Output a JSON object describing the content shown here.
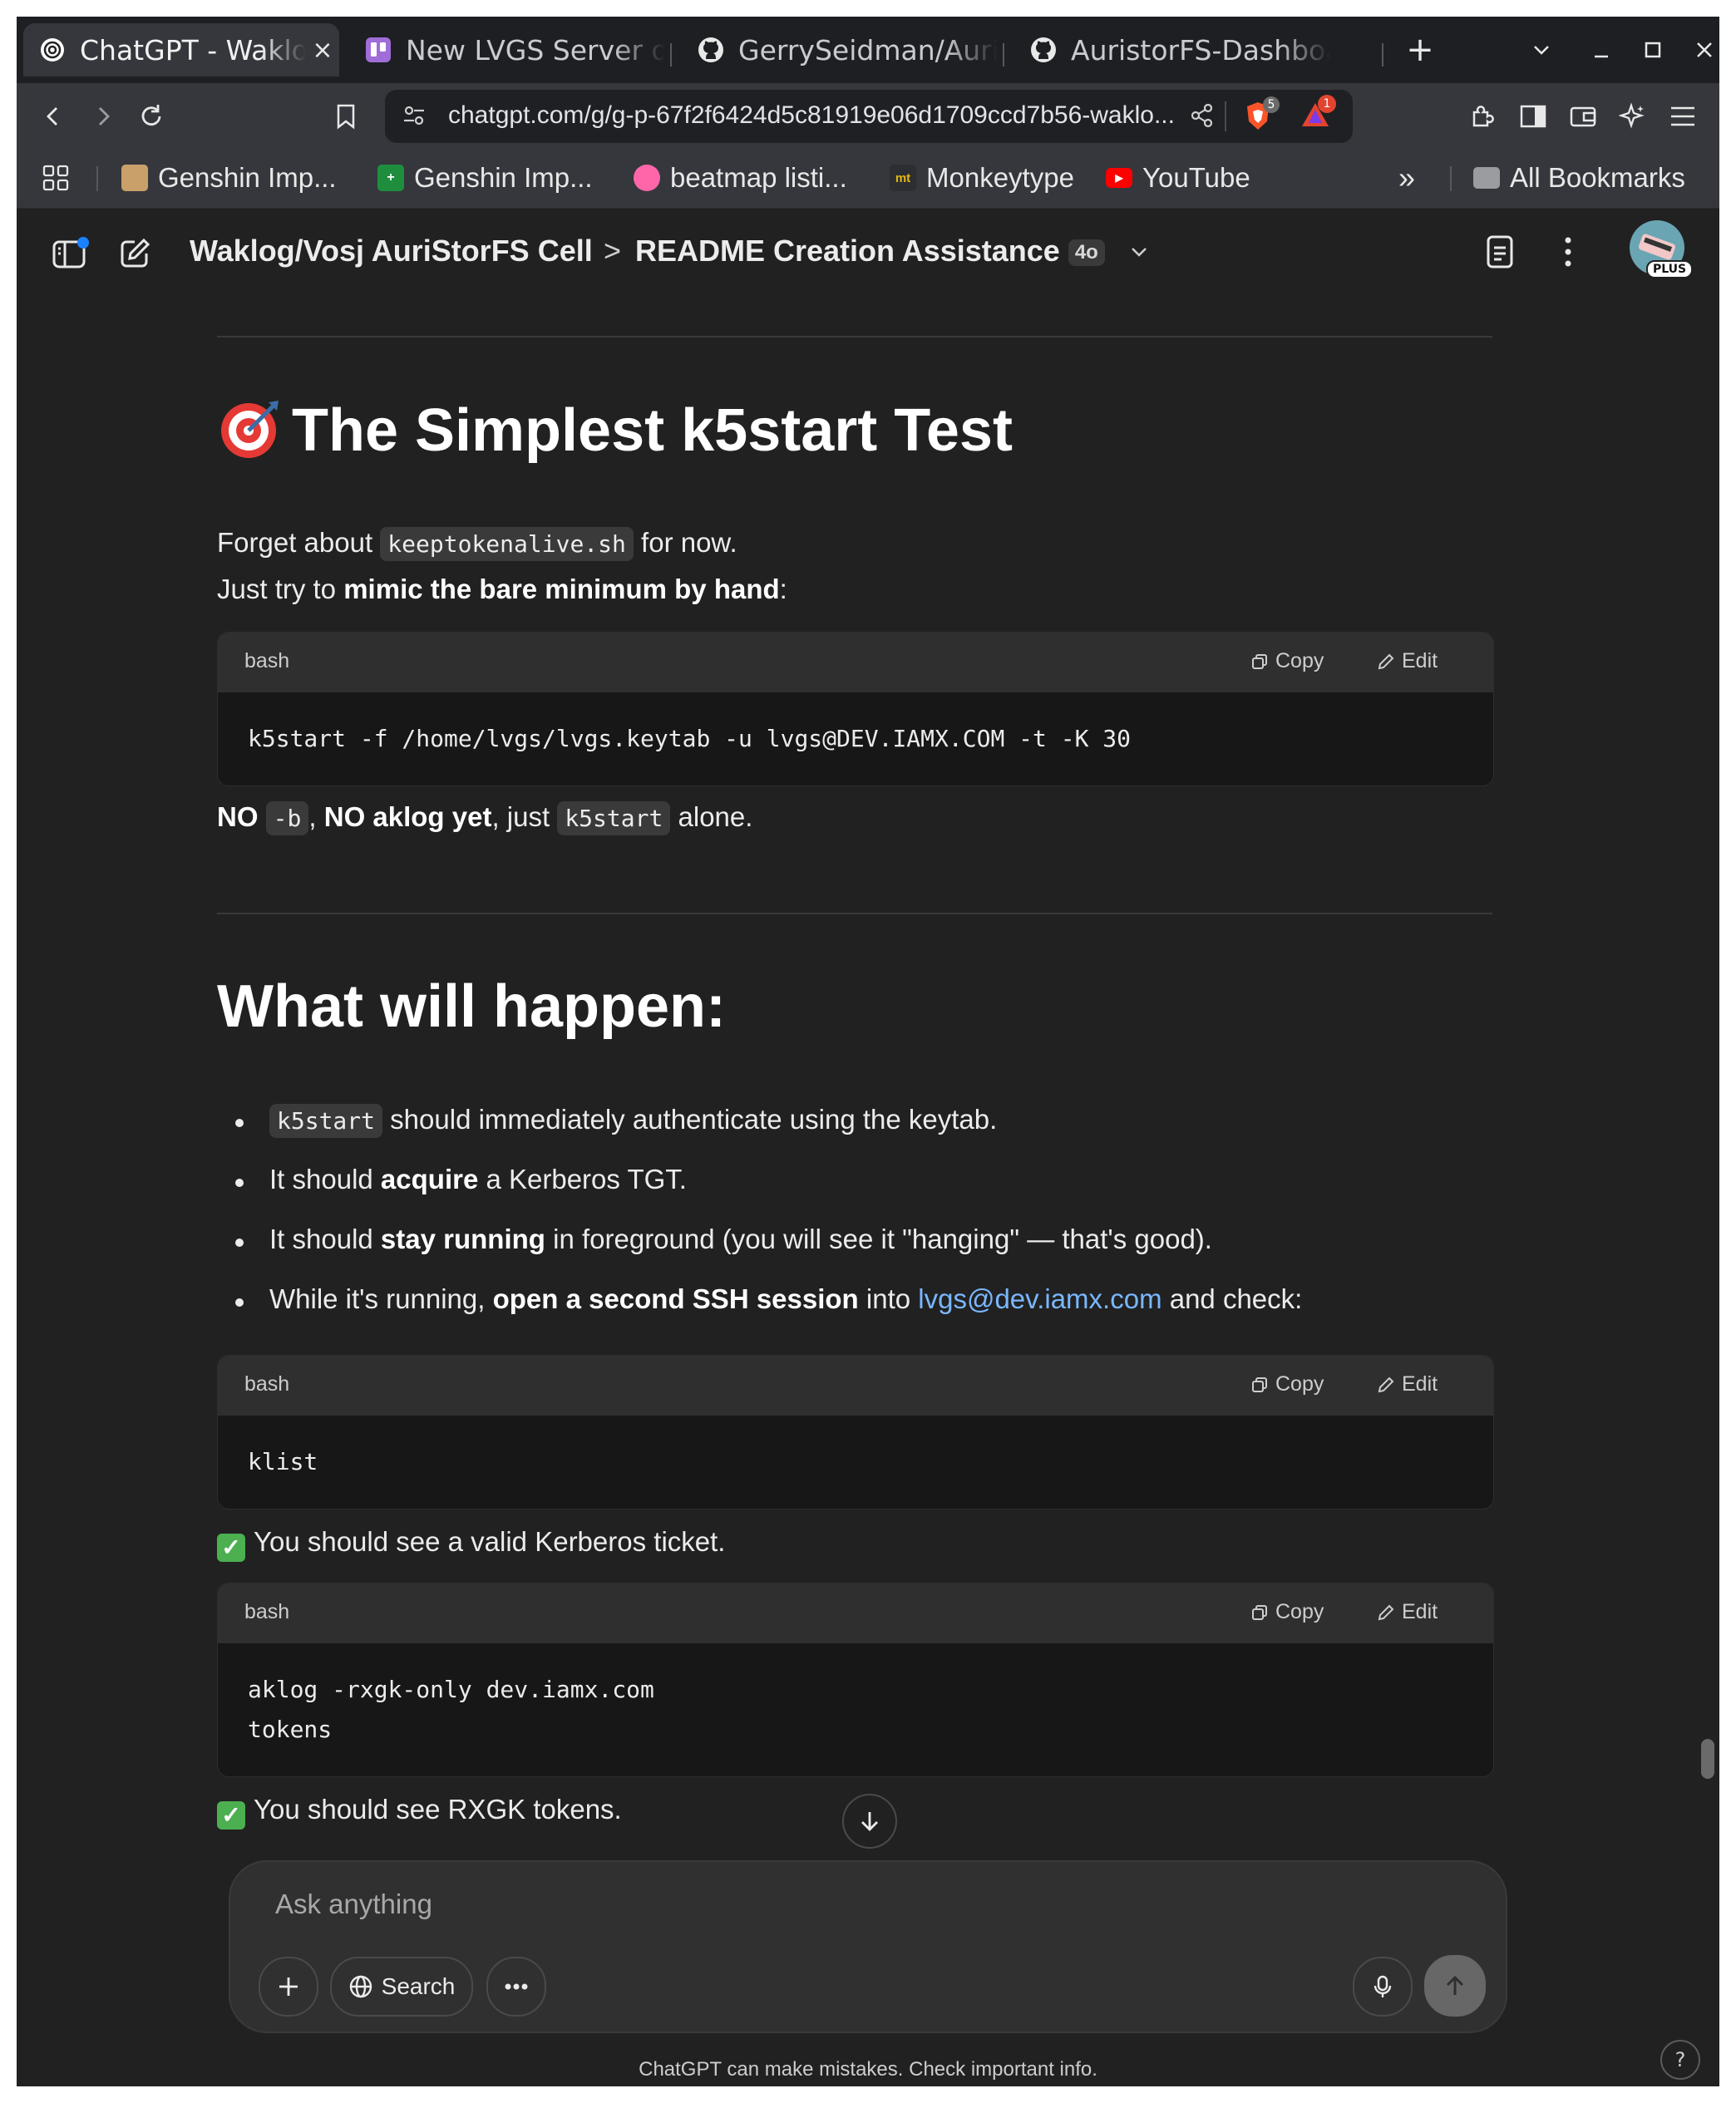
{
  "browser": {
    "tabs": [
      {
        "label": "ChatGPT - Waklog",
        "icon": "chatgpt-icon",
        "active": true
      },
      {
        "label": "New LVGS Server on",
        "icon": "trello-icon",
        "active": false
      },
      {
        "label": "GerrySeidman/Auristor",
        "icon": "github-icon",
        "active": false
      },
      {
        "label": "AuristorFS-Dashboard",
        "icon": "github-icon",
        "active": false
      }
    ],
    "close_glyph": "×",
    "new_tab_glyph": "+",
    "url": "chatgpt.com/g/g-p-67f2f6424d5c81919e06d1709ccd7b56-waklo...",
    "shield_count": "5",
    "alert_count": "1",
    "bookmarks": [
      {
        "label": "Genshin Imp...",
        "icon": "genshin-icon",
        "color": "#c9a06a"
      },
      {
        "label": "Genshin Imp...",
        "icon": "sheets-icon",
        "color": "#1e8e3e"
      },
      {
        "label": "beatmap listi...",
        "icon": "osu-icon",
        "color": "#ff66aa"
      },
      {
        "label": "Monkeytype",
        "icon": "monkeytype-icon",
        "color": "#2c2e31"
      },
      {
        "label": "YouTube",
        "icon": "youtube-icon",
        "color": "#ff0000"
      }
    ],
    "bookmarks_overflow": "»",
    "all_bookmarks": "All Bookmarks"
  },
  "header": {
    "project": "Waklog/Vosj AuriStorFS Cell",
    "separator": ">",
    "chat_title": "README Creation Assistance",
    "model_badge": "4o",
    "plan_badge": "PLUS"
  },
  "content": {
    "h1_emoji": "🎯",
    "h1_title": "The Simplest k5start Test",
    "intro1_pre": "Forget about ",
    "intro1_code": "keeptokenalive.sh",
    "intro1_post": " for now.",
    "intro2_pre": "Just try to ",
    "intro2_bold": "mimic the bare minimum by hand",
    "intro2_post": ":",
    "code_lang": "bash",
    "copy_label": "Copy",
    "edit_label": "Edit",
    "code1": "k5start -f /home/lvgs/lvgs.keytab -u lvgs@DEV.IAMX.COM -t -K 30",
    "note_no": "NO",
    "note_b": "-b",
    "note_no_aklog": "NO aklog yet",
    "note_just": ", just ",
    "note_k5": "k5start",
    "note_alone": " alone.",
    "h2": "What will happen:",
    "bullets": {
      "b1_code": "k5start",
      "b1_text": " should immediately authenticate using the keytab.",
      "b2_pre": "It should ",
      "b2_bold": "acquire",
      "b2_post": " a Kerberos TGT.",
      "b3_pre": "It should ",
      "b3_bold": "stay running",
      "b3_post": " in foreground (you will see it \"hanging\" — that's good).",
      "b4_pre": "While it's running, ",
      "b4_bold": "open a second SSH session",
      "b4_mid": " into ",
      "b4_link": "lvgs@dev.iamx.com",
      "b4_post": " and check:"
    },
    "code2": "klist",
    "check1": "You should see a valid Kerberos ticket.",
    "code3": "aklog -rxgk-only dev.iamx.com\ntokens",
    "check2": "You should see RXGK tokens.",
    "check_glyph": "✓"
  },
  "composer": {
    "placeholder": "Ask anything",
    "search_label": "Search",
    "disclaimer": "ChatGPT can make mistakes. Check important info.",
    "help": "?"
  }
}
